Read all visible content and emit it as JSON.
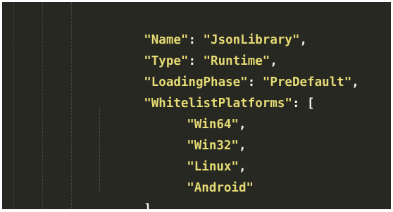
{
  "editor": {
    "theme_colors": {
      "background": "#272822",
      "string": "#e6db74",
      "punctuation": "#f8f8f2"
    },
    "lines": [
      {
        "key": "\"Name\"",
        "sep": ": ",
        "value": "\"JsonLibrary\"",
        "end": ","
      },
      {
        "key": "\"Type\"",
        "sep": ": ",
        "value": "\"Runtime\"",
        "end": ","
      },
      {
        "key": "\"LoadingPhase\"",
        "sep": ": ",
        "value": "\"PreDefault\"",
        "end": ","
      },
      {
        "key": "\"WhitelistPlatforms\"",
        "sep": ": ",
        "value": "[",
        "end": ""
      }
    ],
    "array_items": [
      {
        "value": "\"Win64\"",
        "end": ","
      },
      {
        "value": "\"Win32\"",
        "end": ","
      },
      {
        "value": "\"Linux\"",
        "end": ","
      },
      {
        "value": "\"Android\"",
        "end": ""
      }
    ],
    "closing_bracket": "]"
  }
}
